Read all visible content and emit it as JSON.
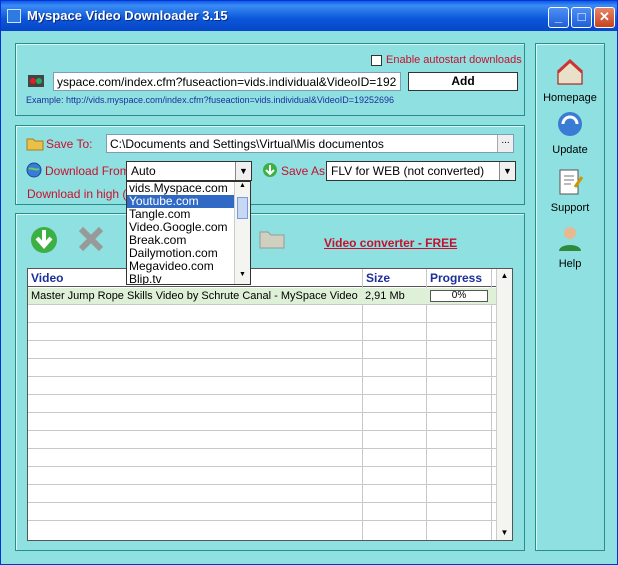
{
  "window": {
    "title": "Myspace Video Downloader  3.15"
  },
  "url_panel": {
    "autostart_label": "Enable autostart downloads",
    "url_value": "yspace.com/index.cfm?fuseaction=vids.individual&VideoID=19252696",
    "add_label": "Add",
    "example": "Example: http://vids.myspace.com/index.cfm?fuseaction=vids.individual&VideoID=19252696"
  },
  "settings": {
    "save_to_label": "Save To:",
    "save_to_value": "C:\\Documents and Settings\\Virtual\\Mis documentos",
    "browse_label": "...",
    "download_from_label": "Download From:",
    "download_from_value": "Auto",
    "save_as_label": "Save As:",
    "save_as_value": "FLV for WEB (not converted)",
    "download_high": "Download in high ( ",
    "dropdown_options": [
      "vids.Myspace.com",
      "Youtube.com",
      "Tangle.com",
      "Video.Google.com",
      "Break.com",
      "Dailymotion.com",
      "Megavideo.com",
      "Blip.tv"
    ]
  },
  "toolbar": {
    "converter_link": "Video converter - FREE"
  },
  "table": {
    "headers": {
      "video": "Video",
      "size": "Size",
      "progress": "Progress"
    },
    "rows": [
      {
        "video": "Master Jump Rope Skills Video by Schrute Canal - MySpace Video",
        "size": "2,91 Mb",
        "progress": "0%"
      }
    ]
  },
  "sidebar": {
    "homepage": "Homepage",
    "update": "Update",
    "support": "Support",
    "help": "Help"
  },
  "colors": {
    "accent_red": "#c8102e",
    "panel": "#8fe0e0",
    "selection": "#316ac5"
  }
}
